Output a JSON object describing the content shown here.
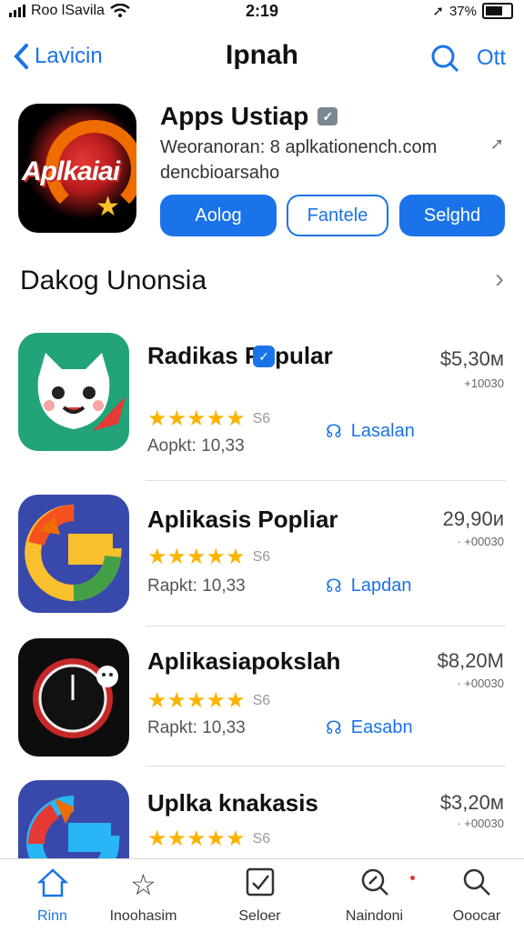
{
  "status_bar": {
    "carrier": "Roo lSavila",
    "time": "2:19",
    "battery_text": "37%"
  },
  "nav": {
    "back_label": "Lavicin",
    "title": "Ipnah",
    "right_label": "Ott"
  },
  "featured": {
    "icon_text": "Aplkaiai",
    "title": "Apps Ustiap",
    "subtitle_line1": "Weoranoran: 8 aplkationench.com",
    "subtitle_line2": "dencbioarsaho",
    "buttons": [
      "Aolog",
      "Fantele",
      "Selghd"
    ]
  },
  "section": {
    "title": "Dakog Unonsia"
  },
  "apps": [
    {
      "name": "Radikas Popular",
      "rating_count": "S6",
      "meta": "Aopkt: 10,33",
      "action": "Lasalan",
      "price": "$5,30м",
      "price_sub": "+10030"
    },
    {
      "name": "Aplikasis Popliar",
      "rating_count": "S6",
      "meta": "Rapkt: 10,33",
      "action": "Lapdan",
      "price": "29,90и",
      "price_sub": "· +00030"
    },
    {
      "name": "Aplikasiapokslah",
      "rating_count": "S6",
      "meta": "Rapkt: 10,33",
      "action": "Easabn",
      "price": "$8,20M",
      "price_sub": "· +00030"
    },
    {
      "name": "Uplka knakasis",
      "rating_count": "S6",
      "meta": "",
      "action": "",
      "price": "$3,20м",
      "price_sub": "· +00030"
    }
  ],
  "tabs": [
    {
      "label": "Rinn",
      "icon": "home-icon"
    },
    {
      "label": "Inoohasim",
      "icon": "star-icon"
    },
    {
      "label": "Seloer",
      "icon": "checkbox-icon"
    },
    {
      "label": "Naindoni",
      "icon": "search-magnifier-icon"
    },
    {
      "label": "Ooocar",
      "icon": "search-icon"
    }
  ],
  "colors": {
    "accent": "#1a73e8",
    "star": "#f9b400"
  }
}
